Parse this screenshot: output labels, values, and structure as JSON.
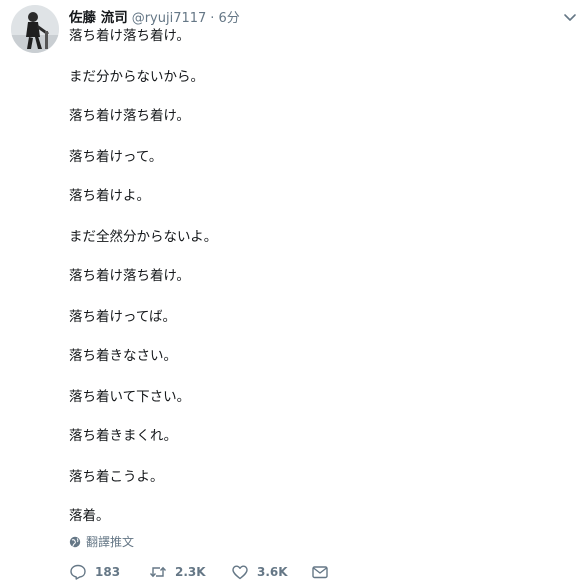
{
  "tweet": {
    "author_name": "佐藤 流司",
    "handle": "@ryuji7117",
    "separator": "·",
    "time": "6分",
    "lines": [
      "落ち着け落ち着け。",
      "まだ分からないから。",
      "落ち着け落ち着け。",
      "落ち着けって。",
      "落ち着けよ。",
      "まだ全然分からないよ。",
      "落ち着け落ち着け。",
      "落ち着けってば。",
      "落ち着きなさい。",
      "落ち着いて下さい。",
      "落ち着きまくれ。",
      "落ち着こうよ。",
      "落着。"
    ],
    "translate_label": "翻譯推文",
    "actions": {
      "reply_count": "183",
      "retweet_count": "2.3K",
      "like_count": "3.6K"
    }
  },
  "icons": {
    "avatar": "avatar-photo",
    "more": "chevron-down-icon",
    "translate": "globe-icon",
    "reply": "reply-icon",
    "retweet": "retweet-icon",
    "like": "heart-icon",
    "dm": "envelope-icon"
  },
  "colors": {
    "text": "#14171a",
    "secondary": "#657786"
  }
}
